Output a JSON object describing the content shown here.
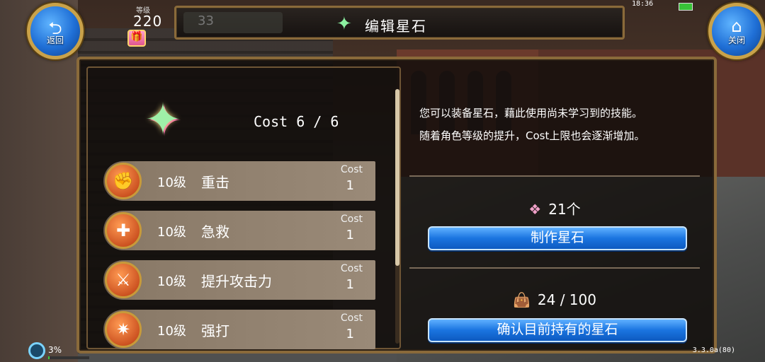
{
  "hud": {
    "back_label": "返回",
    "close_label": "关闭",
    "level_caption": "等级",
    "level_value": "220",
    "shaded_number": "33",
    "clock": "18:36"
  },
  "title": "编辑星石",
  "cost": {
    "text": "Cost 6 / 6"
  },
  "skills": [
    {
      "level": "10级",
      "name": "重击",
      "cost_label": "Cost",
      "cost": "1"
    },
    {
      "level": "10级",
      "name": "急救",
      "cost_label": "Cost",
      "cost": "1"
    },
    {
      "level": "10级",
      "name": "提升攻击力",
      "cost_label": "Cost",
      "cost": "1"
    },
    {
      "level": "10级",
      "name": "强打",
      "cost_label": "Cost",
      "cost": "1"
    }
  ],
  "description": {
    "line1": "您可以装备星石，藉此使用尚未学习到的技能。",
    "line2": "随着角色等级的提升，Cost上限也会逐渐增加。"
  },
  "star_stock": "21个",
  "craft_button": "制作星石",
  "bag_stock": "24 / 100",
  "confirm_button": "确认目前持有的星石",
  "footer": {
    "progress_pct": "3%",
    "progress_fraction": 0.03,
    "version": "3.3.0a(80)"
  },
  "colors": {
    "accent_blue": "#1a74e0",
    "frame_gold": "#8a6a3a"
  },
  "icons": {
    "back": "return-arrow-icon",
    "close": "home-icon",
    "star": "star-gem-icon",
    "bag": "bag-icon"
  }
}
